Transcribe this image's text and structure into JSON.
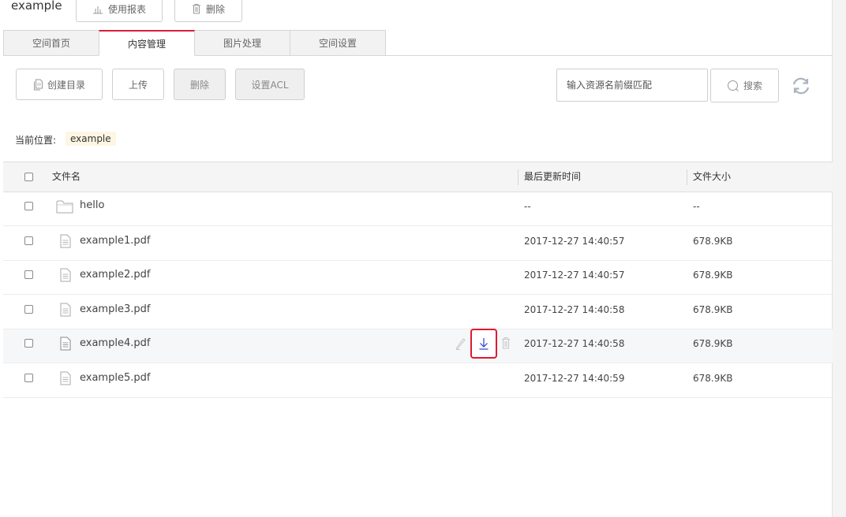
{
  "header": {
    "bucket_name": "example",
    "report_label": "使用报表",
    "delete_label": "删除"
  },
  "tabs": [
    {
      "label": "空间首页",
      "active": false
    },
    {
      "label": "内容管理",
      "active": true
    },
    {
      "label": "图片处理",
      "active": false
    },
    {
      "label": "空间设置",
      "active": false
    }
  ],
  "toolbar": {
    "mkdir_label": "创建目录",
    "upload_label": "上传",
    "delete_label": "删除",
    "acl_label": "设置ACL",
    "search_placeholder": "输入资源名前缀匹配",
    "search_label": "搜索"
  },
  "location": {
    "label": "当前位置:",
    "path": "example"
  },
  "table": {
    "col_name": "文件名",
    "col_time": "最后更新时间",
    "col_size": "文件大小",
    "rows": [
      {
        "name": "hello",
        "type": "folder",
        "time": "--",
        "size": "--"
      },
      {
        "name": "example1.pdf",
        "type": "file",
        "time": "2017-12-27 14:40:57",
        "size": "678.9KB"
      },
      {
        "name": "example2.pdf",
        "type": "file",
        "time": "2017-12-27 14:40:57",
        "size": "678.9KB"
      },
      {
        "name": "example3.pdf",
        "type": "file",
        "time": "2017-12-27 14:40:58",
        "size": "678.9KB"
      },
      {
        "name": "example4.pdf",
        "type": "file",
        "time": "2017-12-27 14:40:58",
        "size": "678.9KB"
      },
      {
        "name": "example5.pdf",
        "type": "file",
        "time": "2017-12-27 14:40:59",
        "size": "678.9KB"
      }
    ]
  },
  "colors": {
    "accent_tab": "#d71e3a",
    "highlight_box": "#e0192e",
    "download_icon": "#2a3fd0",
    "location_tag_bg": "#fdf6e3"
  },
  "icons": [
    "chart-icon",
    "trash-icon",
    "document-icon",
    "search-icon",
    "refresh-icon",
    "folder-icon",
    "file-icon",
    "edit-icon",
    "download-icon"
  ]
}
